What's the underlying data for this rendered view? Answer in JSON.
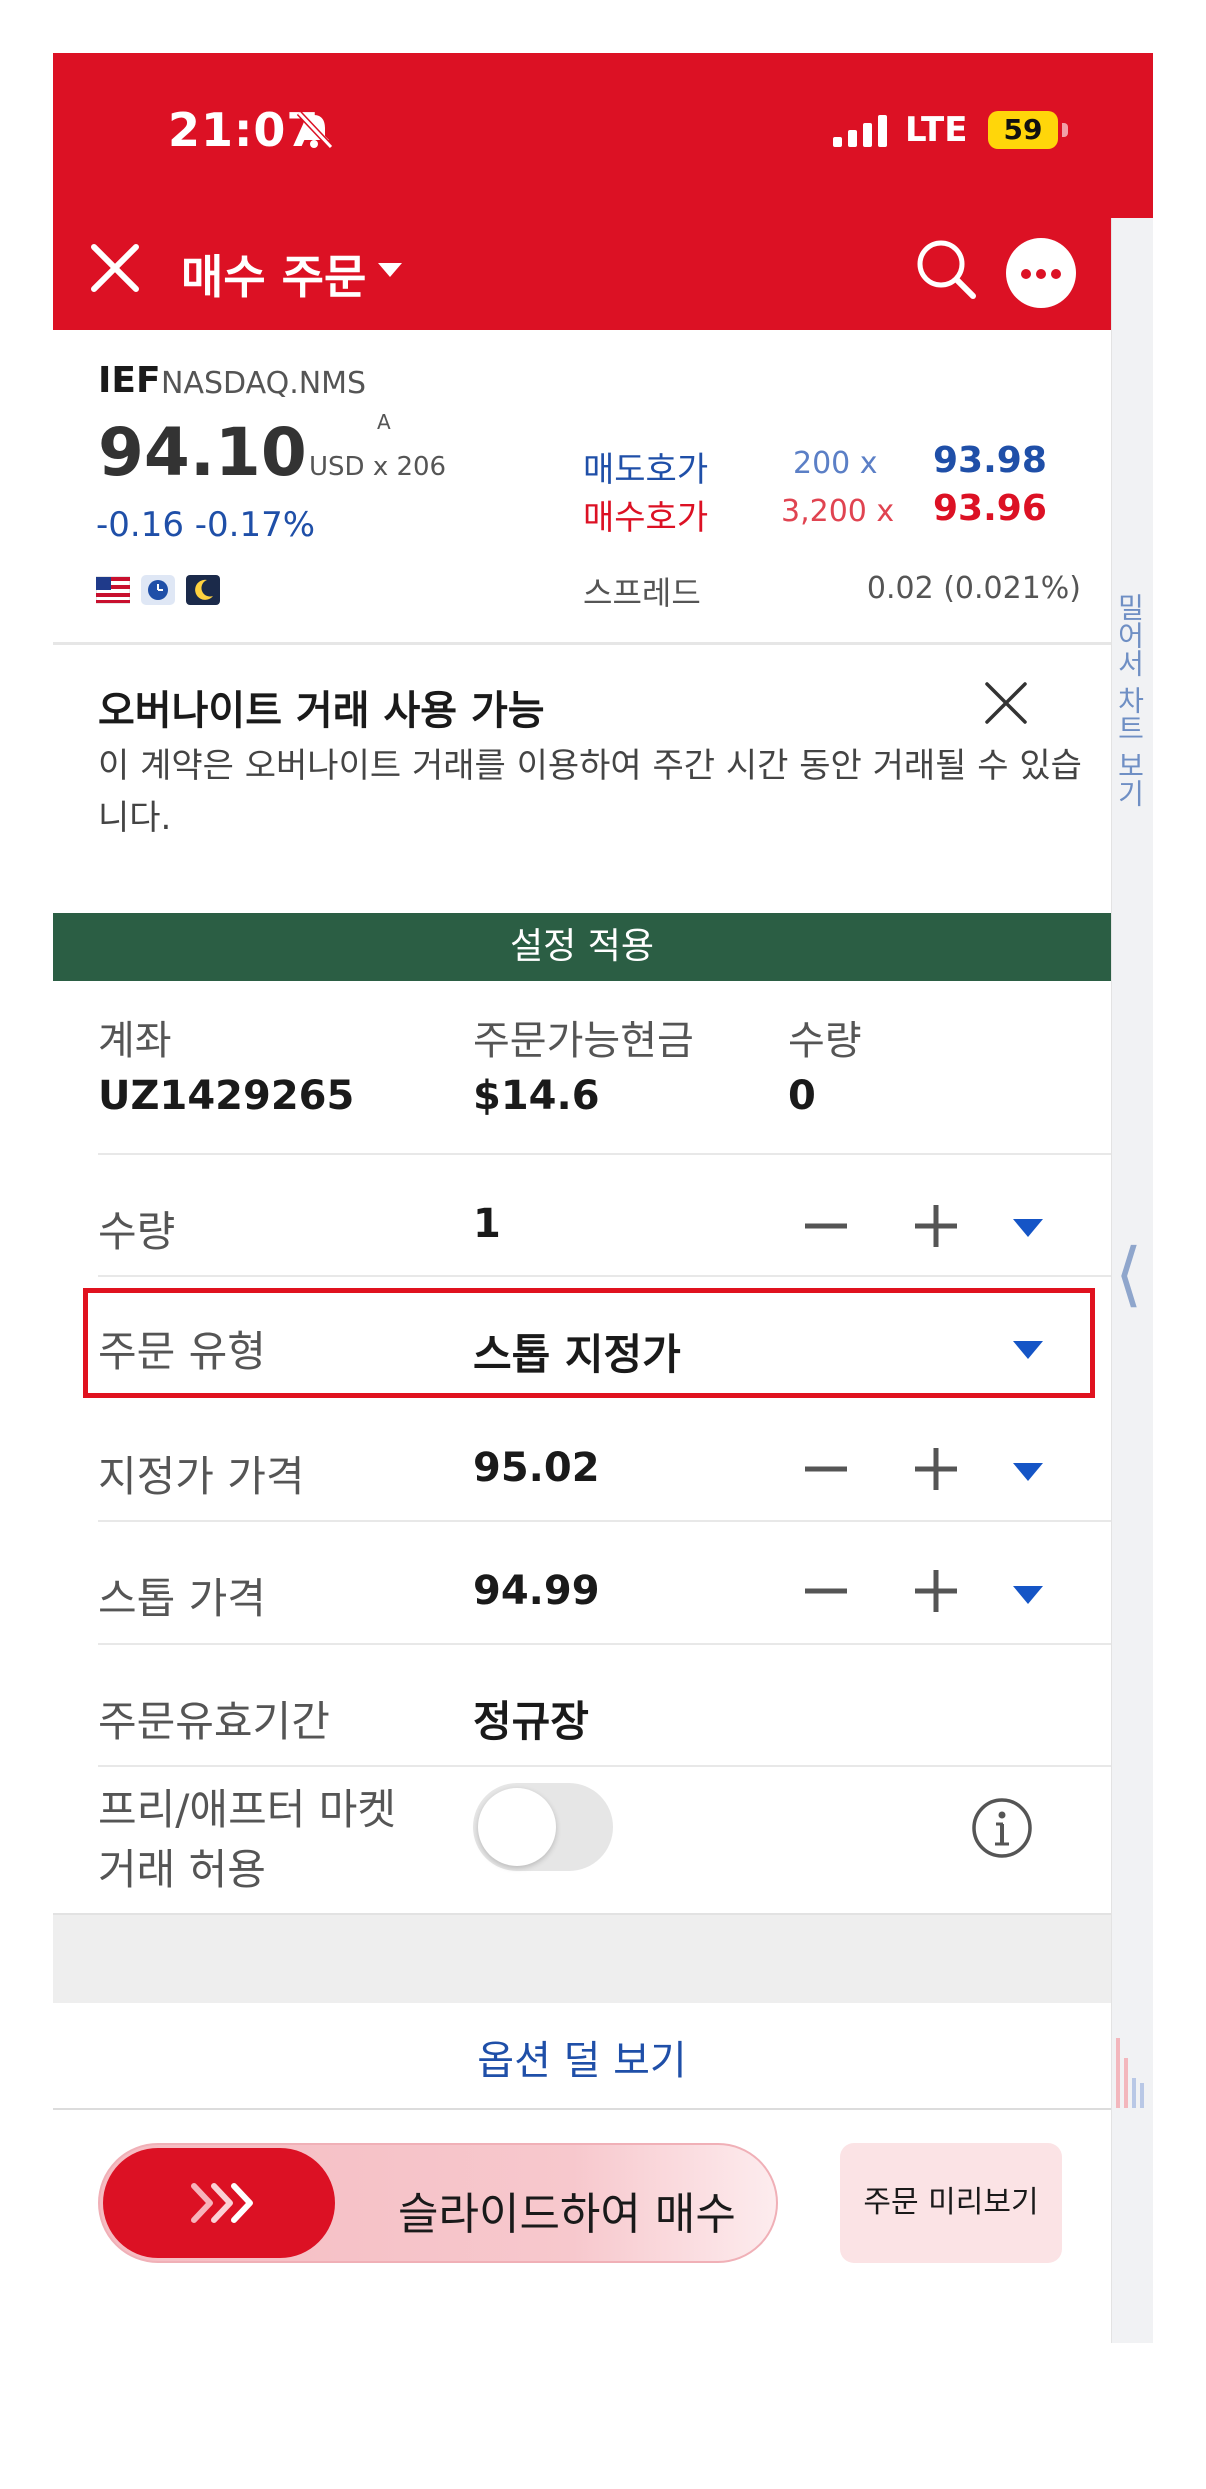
{
  "status_bar": {
    "time": "21:07",
    "network": "LTE",
    "battery": "59"
  },
  "header": {
    "title": "매수 주문"
  },
  "quote": {
    "symbol": "IEF",
    "exchange": "NASDAQ.NMS",
    "last_price": "94.10",
    "price_flag": "A",
    "currency_size": "USD x 206",
    "change": "-0.16  -0.17%",
    "ask_label": "매도호가",
    "ask_size": "200 x",
    "ask_price": "93.98",
    "bid_label": "매수호가",
    "bid_size": "3,200 x",
    "bid_price": "93.96",
    "spread_label": "스프레드",
    "spread_value": "0.02 (0.021%)"
  },
  "notice": {
    "title": "오버나이트 거래 사용 가능",
    "body": "이 계약은 오버나이트 거래를 이용하여 주간 시간 동안 거래될 수 있습니다."
  },
  "apply_settings_label": "설정 적용",
  "account": {
    "account_label": "계좌",
    "account_value": "UZ1429265",
    "cash_label": "주문가능현금",
    "cash_value": "$14.6",
    "qty_label": "수량",
    "qty_value": "0"
  },
  "order_form": {
    "quantity": {
      "label": "수량",
      "value": "1"
    },
    "order_type": {
      "label": "주문 유형",
      "value": "스톱 지정가"
    },
    "limit_price": {
      "label": "지정가 가격",
      "value": "95.02"
    },
    "stop_price": {
      "label": "스톱 가격",
      "value": "94.99"
    },
    "time_in_force": {
      "label": "주문유효기간",
      "value": "정규장"
    },
    "extended_hours": {
      "label_line1": "프리/애프터 마켓",
      "label_line2": "거래 허용",
      "enabled": false
    }
  },
  "less_options_label": "옵션 덜 보기",
  "slide_to_buy_label": "슬라이드하여 매수",
  "preview_button_label": "주문 미리보기",
  "side_panel": {
    "vertical_label": "밀어서 차트 보기"
  },
  "colors": {
    "brand_red": "#dc1124",
    "ask_blue": "#1f4fa8",
    "apply_green": "#2b5e44",
    "highlight_border": "#e0121f"
  }
}
